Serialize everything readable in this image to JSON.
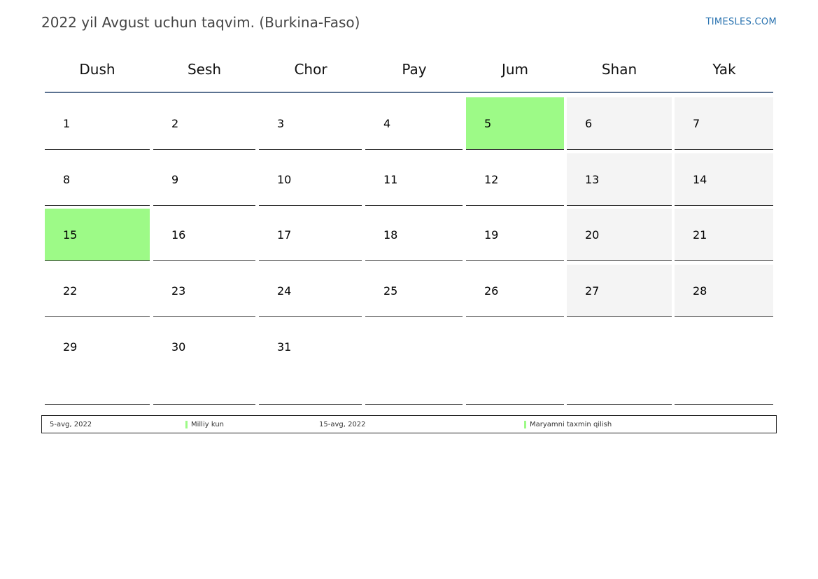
{
  "header": {
    "title": "2022 yil Avgust uchun taqvim. (Burkina-Faso)",
    "site": "TIMESLES.COM"
  },
  "weekdays": [
    "Dush",
    "Sesh",
    "Chor",
    "Pay",
    "Jum",
    "Shan",
    "Yak"
  ],
  "weeks": [
    [
      "1",
      "2",
      "3",
      "4",
      "5",
      "6",
      "7"
    ],
    [
      "8",
      "9",
      "10",
      "11",
      "12",
      "13",
      "14"
    ],
    [
      "15",
      "16",
      "17",
      "18",
      "19",
      "20",
      "21"
    ],
    [
      "22",
      "23",
      "24",
      "25",
      "26",
      "27",
      "28"
    ],
    [
      "29",
      "30",
      "31",
      "",
      "",
      "",
      ""
    ]
  ],
  "holidays": [
    "5",
    "15"
  ],
  "colors": {
    "holiday": "#9dfa87",
    "weekend": "#f4f4f4",
    "header_rule": "#5b7291",
    "link": "#2a73b0"
  },
  "legend": [
    {
      "date": "5-avg, 2022",
      "name": "Milliy kun"
    },
    {
      "date": "15-avg, 2022",
      "name": "Maryamni taxmin qilish"
    }
  ]
}
